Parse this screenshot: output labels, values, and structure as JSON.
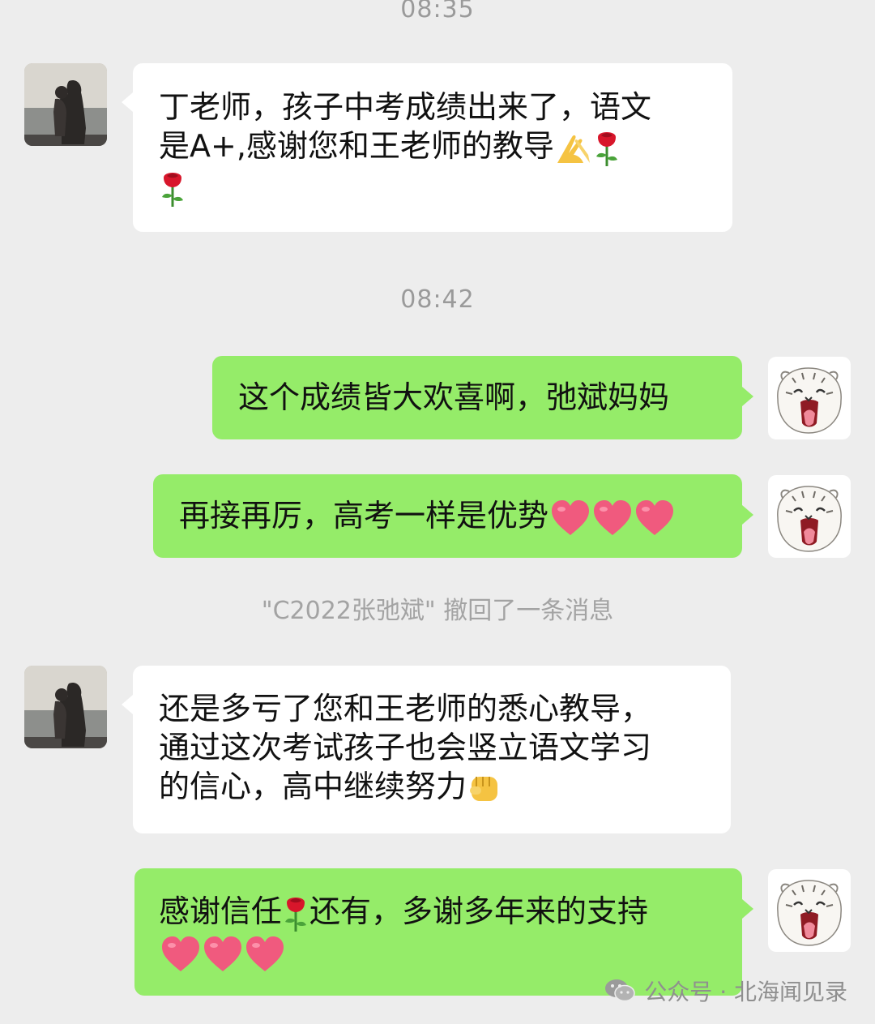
{
  "timestamps": [
    "08:35",
    "08:42"
  ],
  "messages": [
    {
      "side": "left",
      "lines": [
        "丁老师，孩子中考成绩出来了，语文",
        "是A+,感谢您和王老师的教导"
      ]
    },
    {
      "side": "right",
      "text": "这个成绩皆大欢喜啊，弛斌妈妈"
    },
    {
      "side": "right",
      "text": "再接再厉，高考一样是优势"
    },
    {
      "side": "left",
      "lines": [
        "还是多亏了您和王老师的悉心教导，",
        "通过这次考试孩子也会竖立语文学习",
        "的信心，高中继续努力"
      ]
    },
    {
      "side": "right",
      "lines": [
        "感谢信任",
        "还有，多谢多年来的支持"
      ]
    }
  ],
  "system_note": "\"C2022张弛斌\" 撤回了一条消息",
  "watermark": "公众号 · 北海闻见录",
  "emoji_names": [
    "pray-hands-icon",
    "rose-icon",
    "heart-icon",
    "fist-icon"
  ],
  "colors": {
    "background": "#ededed",
    "left_bubble": "#ffffff",
    "right_bubble": "#95ec69",
    "timestamp": "#9a9a9a"
  }
}
